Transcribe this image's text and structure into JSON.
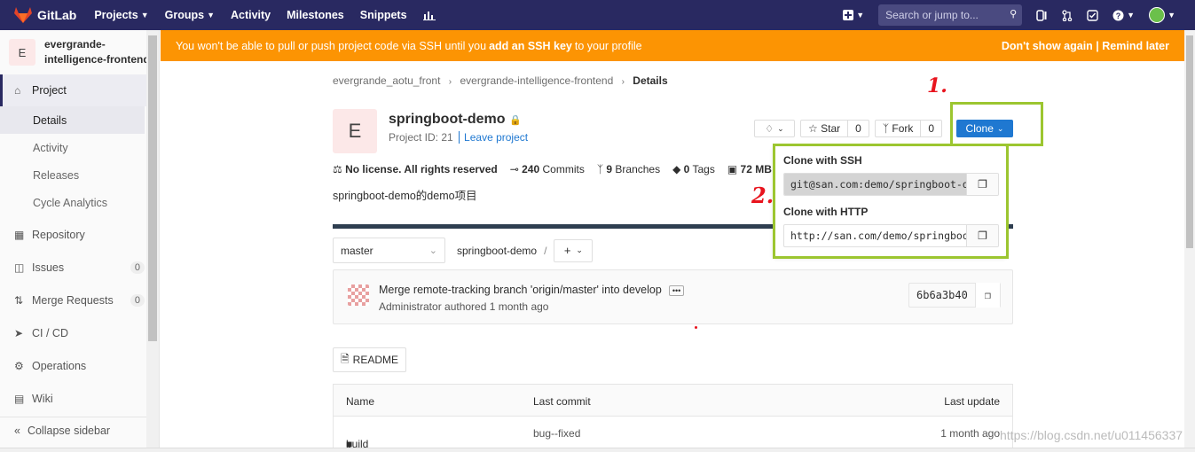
{
  "topnav": {
    "brand": "GitLab",
    "items": [
      {
        "label": "Projects",
        "dropdown": true
      },
      {
        "label": "Groups",
        "dropdown": true
      },
      {
        "label": "Activity",
        "dropdown": false
      },
      {
        "label": "Milestones",
        "dropdown": false
      },
      {
        "label": "Snippets",
        "dropdown": false
      }
    ],
    "search_placeholder": "Search or jump to..."
  },
  "alert": {
    "text_before": "You won't be able to pull or push project code via SSH until you ",
    "link": "add an SSH key",
    "text_after": " to your profile",
    "dont_show": "Don't show again",
    "remind": "Remind later"
  },
  "sidebar": {
    "project_initial": "E",
    "project_name_line1": "evergrande-",
    "project_name_line2": "intelligence-frontend",
    "project_label": "Project",
    "sub_items": [
      "Details",
      "Activity",
      "Releases",
      "Cycle Analytics"
    ],
    "items": [
      {
        "label": "Repository",
        "count": ""
      },
      {
        "label": "Issues",
        "count": "0"
      },
      {
        "label": "Merge Requests",
        "count": "0"
      },
      {
        "label": "CI / CD",
        "count": ""
      },
      {
        "label": "Operations",
        "count": ""
      },
      {
        "label": "Wiki",
        "count": ""
      }
    ],
    "collapse": "Collapse sidebar"
  },
  "breadcrumb": {
    "items": [
      "evergrande_aotu_front",
      "evergrande-intelligence-frontend"
    ],
    "current": "Details"
  },
  "project": {
    "initial": "E",
    "name": "springboot-demo",
    "id_text": "Project ID: 21",
    "leave": "Leave project",
    "star_label": "Star",
    "star_count": "0",
    "fork_label": "Fork",
    "fork_count": "0",
    "clone_label": "Clone",
    "license": "No license. All rights reserved",
    "commits_count": "240",
    "commits_label": "Commits",
    "branches_count": "9",
    "branches_label": "Branches",
    "tags_count": "0",
    "tags_label": "Tags",
    "size": "72 MB",
    "description": "springboot-demo的demo项目"
  },
  "branch": {
    "selected": "master",
    "path": "springboot-demo",
    "sep": "/"
  },
  "commit": {
    "message": "Merge remote-tracking branch 'origin/master' into develop",
    "author": "Administrator",
    "authored": "authored",
    "time": "1 month ago",
    "sha": "6b6a3b40"
  },
  "readme_label": "README",
  "table": {
    "headers": [
      "Name",
      "Last commit",
      "Last update"
    ],
    "rows": [
      {
        "name": "build",
        "commit": "bug--fixed",
        "updated": "1 month ago"
      }
    ]
  },
  "clone_dropdown": {
    "ssh_label": "Clone with SSH",
    "ssh_url": "git@san.com:demo/springboot-demo.git",
    "http_label": "Clone with HTTP",
    "http_url": "http://san.com/demo/springboot-demo.git"
  },
  "annotations": {
    "step1": "1.",
    "step2": "2."
  },
  "watermark": "https://blog.csdn.net/u011456337",
  "colors": {
    "nav": "#292961",
    "alert": "#fc9403",
    "primary": "#1f78d1",
    "highlight": "#9cc630",
    "annotation": "#e8141e"
  }
}
